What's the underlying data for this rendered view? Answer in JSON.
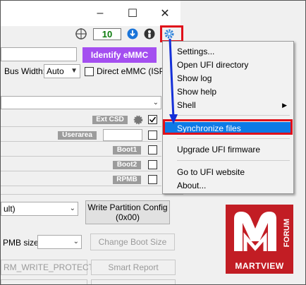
{
  "window": {
    "minimize_glyph": "–",
    "maximize_glyph": "☐",
    "close_glyph": "✕"
  },
  "toolbar": {
    "counter": "10",
    "icons": [
      "target-icon",
      "download-icon",
      "person-icon",
      "gear-icon"
    ]
  },
  "main": {
    "identify_button": "Identify eMMC",
    "bus_width_label": "Bus Width:",
    "bus_width_value": "Auto",
    "direct_emmc_label": "Direct eMMC (ISP)",
    "partitions": [
      {
        "tag": "Ext CSD"
      },
      {
        "tag": "Userarea"
      },
      {
        "tag": "Boot1"
      },
      {
        "tag": "Boot2"
      },
      {
        "tag": "RPMB"
      }
    ],
    "partition_select_value": "ult)",
    "write_partition_config": "Write Partition Config\n(0x00)",
    "rpmb_size_label": "PMB size:",
    "change_boot_size": "Change Boot Size",
    "rm_write_protect": "RM_WRITE_PROTECT",
    "smart_report": "Smart Report"
  },
  "menu": {
    "items": [
      {
        "label": "Settings..."
      },
      {
        "label": "Open UFI directory"
      },
      {
        "label": "Show log"
      },
      {
        "label": "Show help"
      },
      {
        "label": "Shell",
        "submenu_arrow": "▶"
      },
      {
        "label": "Synchronize files"
      },
      {
        "label": "Upgrade UFI firmware"
      },
      {
        "label": "Go to UFI website"
      },
      {
        "label": "About..."
      }
    ],
    "highlighted_index": 5
  },
  "logo": {
    "brand": "MARTVIEW",
    "side_text": "FORUM"
  },
  "colors": {
    "highlight": "#0d7ae6",
    "annotation_red": "#e0101a",
    "annotation_arrow": "#1530d8",
    "purple_button": "#a44ff0",
    "logo_red": "#c21d24"
  }
}
